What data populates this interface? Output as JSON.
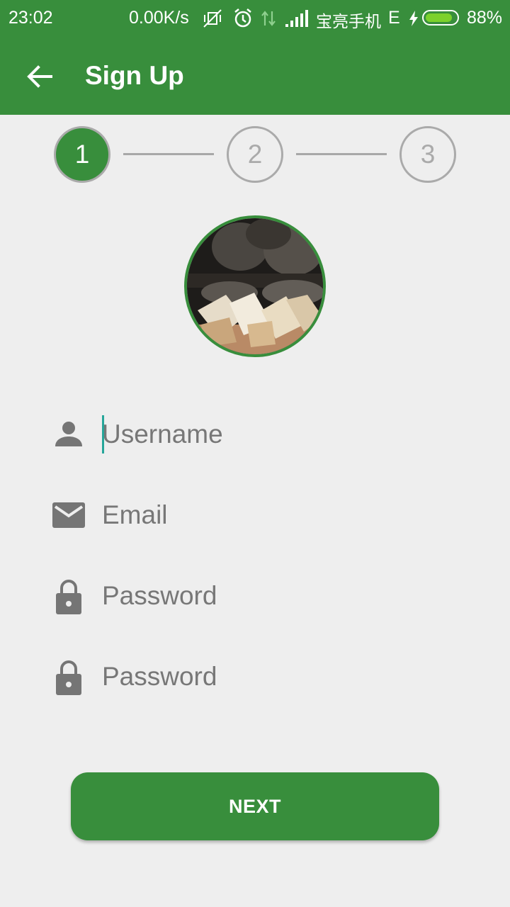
{
  "status_bar": {
    "time": "23:02",
    "speed": "0.00K/s",
    "carrier": "宝亮手机",
    "network": "E",
    "battery": "88%",
    "battery_level": 0.88
  },
  "appbar": {
    "title": "Sign Up",
    "back_icon": "arrow-left-icon"
  },
  "stepper": {
    "steps": [
      "1",
      "2",
      "3"
    ],
    "active": 0
  },
  "form": {
    "username_placeholder": "Username",
    "email_placeholder": "Email",
    "password_placeholder": "Password",
    "confirm_password_placeholder": "Password"
  },
  "next_button": "NEXT",
  "colors": {
    "primary": "#388e3c",
    "background": "#eeeeee",
    "inactive": "#aaaaaa",
    "cursor": "#26a69a"
  }
}
